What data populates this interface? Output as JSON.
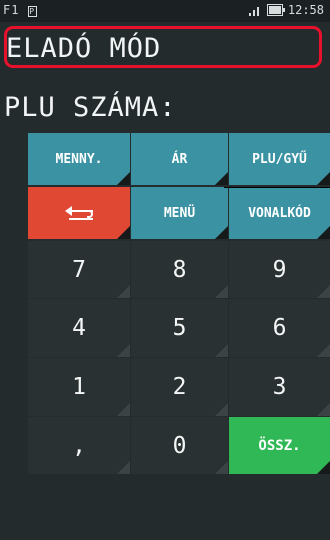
{
  "statusbar": {
    "left_label": "F1",
    "left_icon": "p-icon",
    "time": "12:58"
  },
  "mode_title": "ELADÓ MÓD",
  "prompt": "PLU SZÁMA:",
  "keys": {
    "menny": "MENNY.",
    "ar": "ÁR",
    "plu": "PLU/GYŰ",
    "menu": "MENÜ",
    "vonalkod": "VONALKÓD",
    "n7": "7",
    "n8": "8",
    "n9": "9",
    "n4": "4",
    "n5": "5",
    "n6": "6",
    "n1": "1",
    "n2": "2",
    "n3": "3",
    "comma": ",",
    "n0": "0",
    "ossz": "ÖSSZ."
  },
  "colors": {
    "teal": "#3a92a2",
    "red": "#e04834",
    "green": "#2fb855",
    "highlight": "#e8112d"
  }
}
